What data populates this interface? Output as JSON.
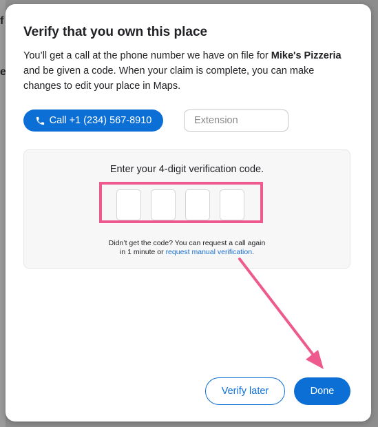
{
  "background": {
    "edge_letters": [
      "f",
      "e"
    ]
  },
  "dialog": {
    "title": "Verify that you own this place",
    "description": {
      "before": "You’ll get a call at the phone number we have on file for ",
      "business": "Mike's Pizzeria",
      "after": " and be given a code. When your claim is complete, you can make changes to edit your place in Maps."
    },
    "call_button": {
      "label": "Call +1 (234) 567-8910",
      "icon": "phone-icon"
    },
    "extension": {
      "placeholder": "Extension",
      "value": ""
    },
    "code_panel": {
      "prompt": "Enter your 4-digit verification code.",
      "digits": [
        "",
        "",
        "",
        ""
      ],
      "help_line1": "Didn’t get the code? You can request a call again",
      "help_line2_prefix": "in 1 minute or ",
      "help_link": "request manual verification",
      "help_line2_suffix": "."
    },
    "buttons": {
      "verify_later": "Verify later",
      "done": "Done"
    }
  },
  "annotation": {
    "color": "#ee5a8e"
  },
  "colors": {
    "primary": "#0b6fd6",
    "link": "#1a6fd0",
    "text": "#202124",
    "panel": "#f7f7f8"
  }
}
